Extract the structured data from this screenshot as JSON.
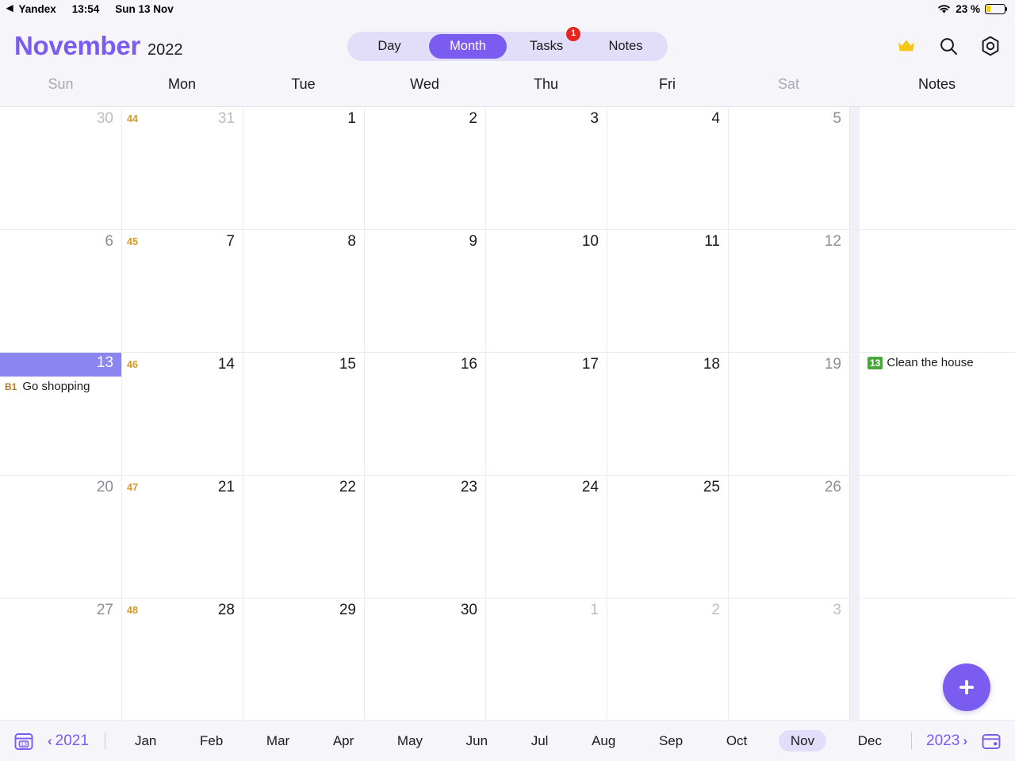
{
  "statusbar": {
    "back_label": "Yandex",
    "back_icon": "back-triangle-icon",
    "time": "13:54",
    "date": "Sun 13 Nov",
    "wifi_icon": "wifi-icon",
    "battery_percent": "23 %",
    "battery_level": 23,
    "battery_color": "#ffcc00"
  },
  "header": {
    "month": "November",
    "year": "2022",
    "accent_color": "#7b5cf0",
    "tabs": [
      {
        "label": "Day",
        "active": false,
        "badge": null
      },
      {
        "label": "Month",
        "active": true,
        "badge": null
      },
      {
        "label": "Tasks",
        "active": false,
        "badge": "1"
      },
      {
        "label": "Notes",
        "active": false,
        "badge": null
      }
    ],
    "icons": [
      {
        "name": "crown-icon",
        "color": "#f5c518"
      },
      {
        "name": "search-icon",
        "color": "#1b1b1f"
      },
      {
        "name": "settings-icon",
        "color": "#1b1b1f"
      }
    ]
  },
  "weekdays": [
    {
      "label": "Sun",
      "weekend": true
    },
    {
      "label": "Mon",
      "weekend": false
    },
    {
      "label": "Tue",
      "weekend": false
    },
    {
      "label": "Wed",
      "weekend": false
    },
    {
      "label": "Thu",
      "weekend": false
    },
    {
      "label": "Fri",
      "weekend": false
    },
    {
      "label": "Sat",
      "weekend": true
    },
    {
      "label": "Notes",
      "weekend": false
    }
  ],
  "weeks": [
    {
      "week_number": "44",
      "days": [
        {
          "num": "30",
          "other_month": true,
          "weekend": true,
          "today": false,
          "events": []
        },
        {
          "num": "31",
          "other_month": true,
          "weekend": false,
          "today": false,
          "events": []
        },
        {
          "num": "1",
          "other_month": false,
          "weekend": false,
          "today": false,
          "events": []
        },
        {
          "num": "2",
          "other_month": false,
          "weekend": false,
          "today": false,
          "events": []
        },
        {
          "num": "3",
          "other_month": false,
          "weekend": false,
          "today": false,
          "events": []
        },
        {
          "num": "4",
          "other_month": false,
          "weekend": false,
          "today": false,
          "events": []
        },
        {
          "num": "5",
          "other_month": false,
          "weekend": true,
          "today": false,
          "events": []
        }
      ],
      "notes": []
    },
    {
      "week_number": "45",
      "days": [
        {
          "num": "6",
          "other_month": false,
          "weekend": true,
          "today": false,
          "events": []
        },
        {
          "num": "7",
          "other_month": false,
          "weekend": false,
          "today": false,
          "events": []
        },
        {
          "num": "8",
          "other_month": false,
          "weekend": false,
          "today": false,
          "events": []
        },
        {
          "num": "9",
          "other_month": false,
          "weekend": false,
          "today": false,
          "events": []
        },
        {
          "num": "10",
          "other_month": false,
          "weekend": false,
          "today": false,
          "events": []
        },
        {
          "num": "11",
          "other_month": false,
          "weekend": false,
          "today": false,
          "events": []
        },
        {
          "num": "12",
          "other_month": false,
          "weekend": true,
          "today": false,
          "events": []
        }
      ],
      "notes": []
    },
    {
      "week_number": "46",
      "days": [
        {
          "num": "13",
          "other_month": false,
          "weekend": true,
          "today": true,
          "events": [
            {
              "tag": "B1",
              "tag_style": "plain",
              "text": "Go shopping"
            }
          ]
        },
        {
          "num": "14",
          "other_month": false,
          "weekend": false,
          "today": false,
          "events": []
        },
        {
          "num": "15",
          "other_month": false,
          "weekend": false,
          "today": false,
          "events": []
        },
        {
          "num": "16",
          "other_month": false,
          "weekend": false,
          "today": false,
          "events": []
        },
        {
          "num": "17",
          "other_month": false,
          "weekend": false,
          "today": false,
          "events": []
        },
        {
          "num": "18",
          "other_month": false,
          "weekend": false,
          "today": false,
          "events": []
        },
        {
          "num": "19",
          "other_month": false,
          "weekend": true,
          "today": false,
          "events": []
        }
      ],
      "notes": [
        {
          "tag": "13",
          "tag_style": "green",
          "text": "Clean the house"
        }
      ]
    },
    {
      "week_number": "47",
      "days": [
        {
          "num": "20",
          "other_month": false,
          "weekend": true,
          "today": false,
          "events": []
        },
        {
          "num": "21",
          "other_month": false,
          "weekend": false,
          "today": false,
          "events": []
        },
        {
          "num": "22",
          "other_month": false,
          "weekend": false,
          "today": false,
          "events": []
        },
        {
          "num": "23",
          "other_month": false,
          "weekend": false,
          "today": false,
          "events": []
        },
        {
          "num": "24",
          "other_month": false,
          "weekend": false,
          "today": false,
          "events": []
        },
        {
          "num": "25",
          "other_month": false,
          "weekend": false,
          "today": false,
          "events": []
        },
        {
          "num": "26",
          "other_month": false,
          "weekend": true,
          "today": false,
          "events": []
        }
      ],
      "notes": []
    },
    {
      "week_number": "48",
      "days": [
        {
          "num": "27",
          "other_month": false,
          "weekend": true,
          "today": false,
          "events": []
        },
        {
          "num": "28",
          "other_month": false,
          "weekend": false,
          "today": false,
          "events": []
        },
        {
          "num": "29",
          "other_month": false,
          "weekend": false,
          "today": false,
          "events": []
        },
        {
          "num": "30",
          "other_month": false,
          "weekend": false,
          "today": false,
          "events": []
        },
        {
          "num": "1",
          "other_month": true,
          "weekend": false,
          "today": false,
          "events": []
        },
        {
          "num": "2",
          "other_month": true,
          "weekend": false,
          "today": false,
          "events": []
        },
        {
          "num": "3",
          "other_month": true,
          "weekend": true,
          "today": false,
          "events": []
        }
      ],
      "notes": []
    }
  ],
  "fab": {
    "name": "add-button",
    "label": "+"
  },
  "bottombar": {
    "left_icon": "calendar-day-icon",
    "left_icon_label": "13",
    "prev_year": "2021",
    "next_year": "2023",
    "months": [
      "Jan",
      "Feb",
      "Mar",
      "Apr",
      "May",
      "Jun",
      "Jul",
      "Aug",
      "Sep",
      "Oct",
      "Nov",
      "Dec"
    ],
    "selected_month": "Nov",
    "right_icon": "calendar-card-icon"
  }
}
